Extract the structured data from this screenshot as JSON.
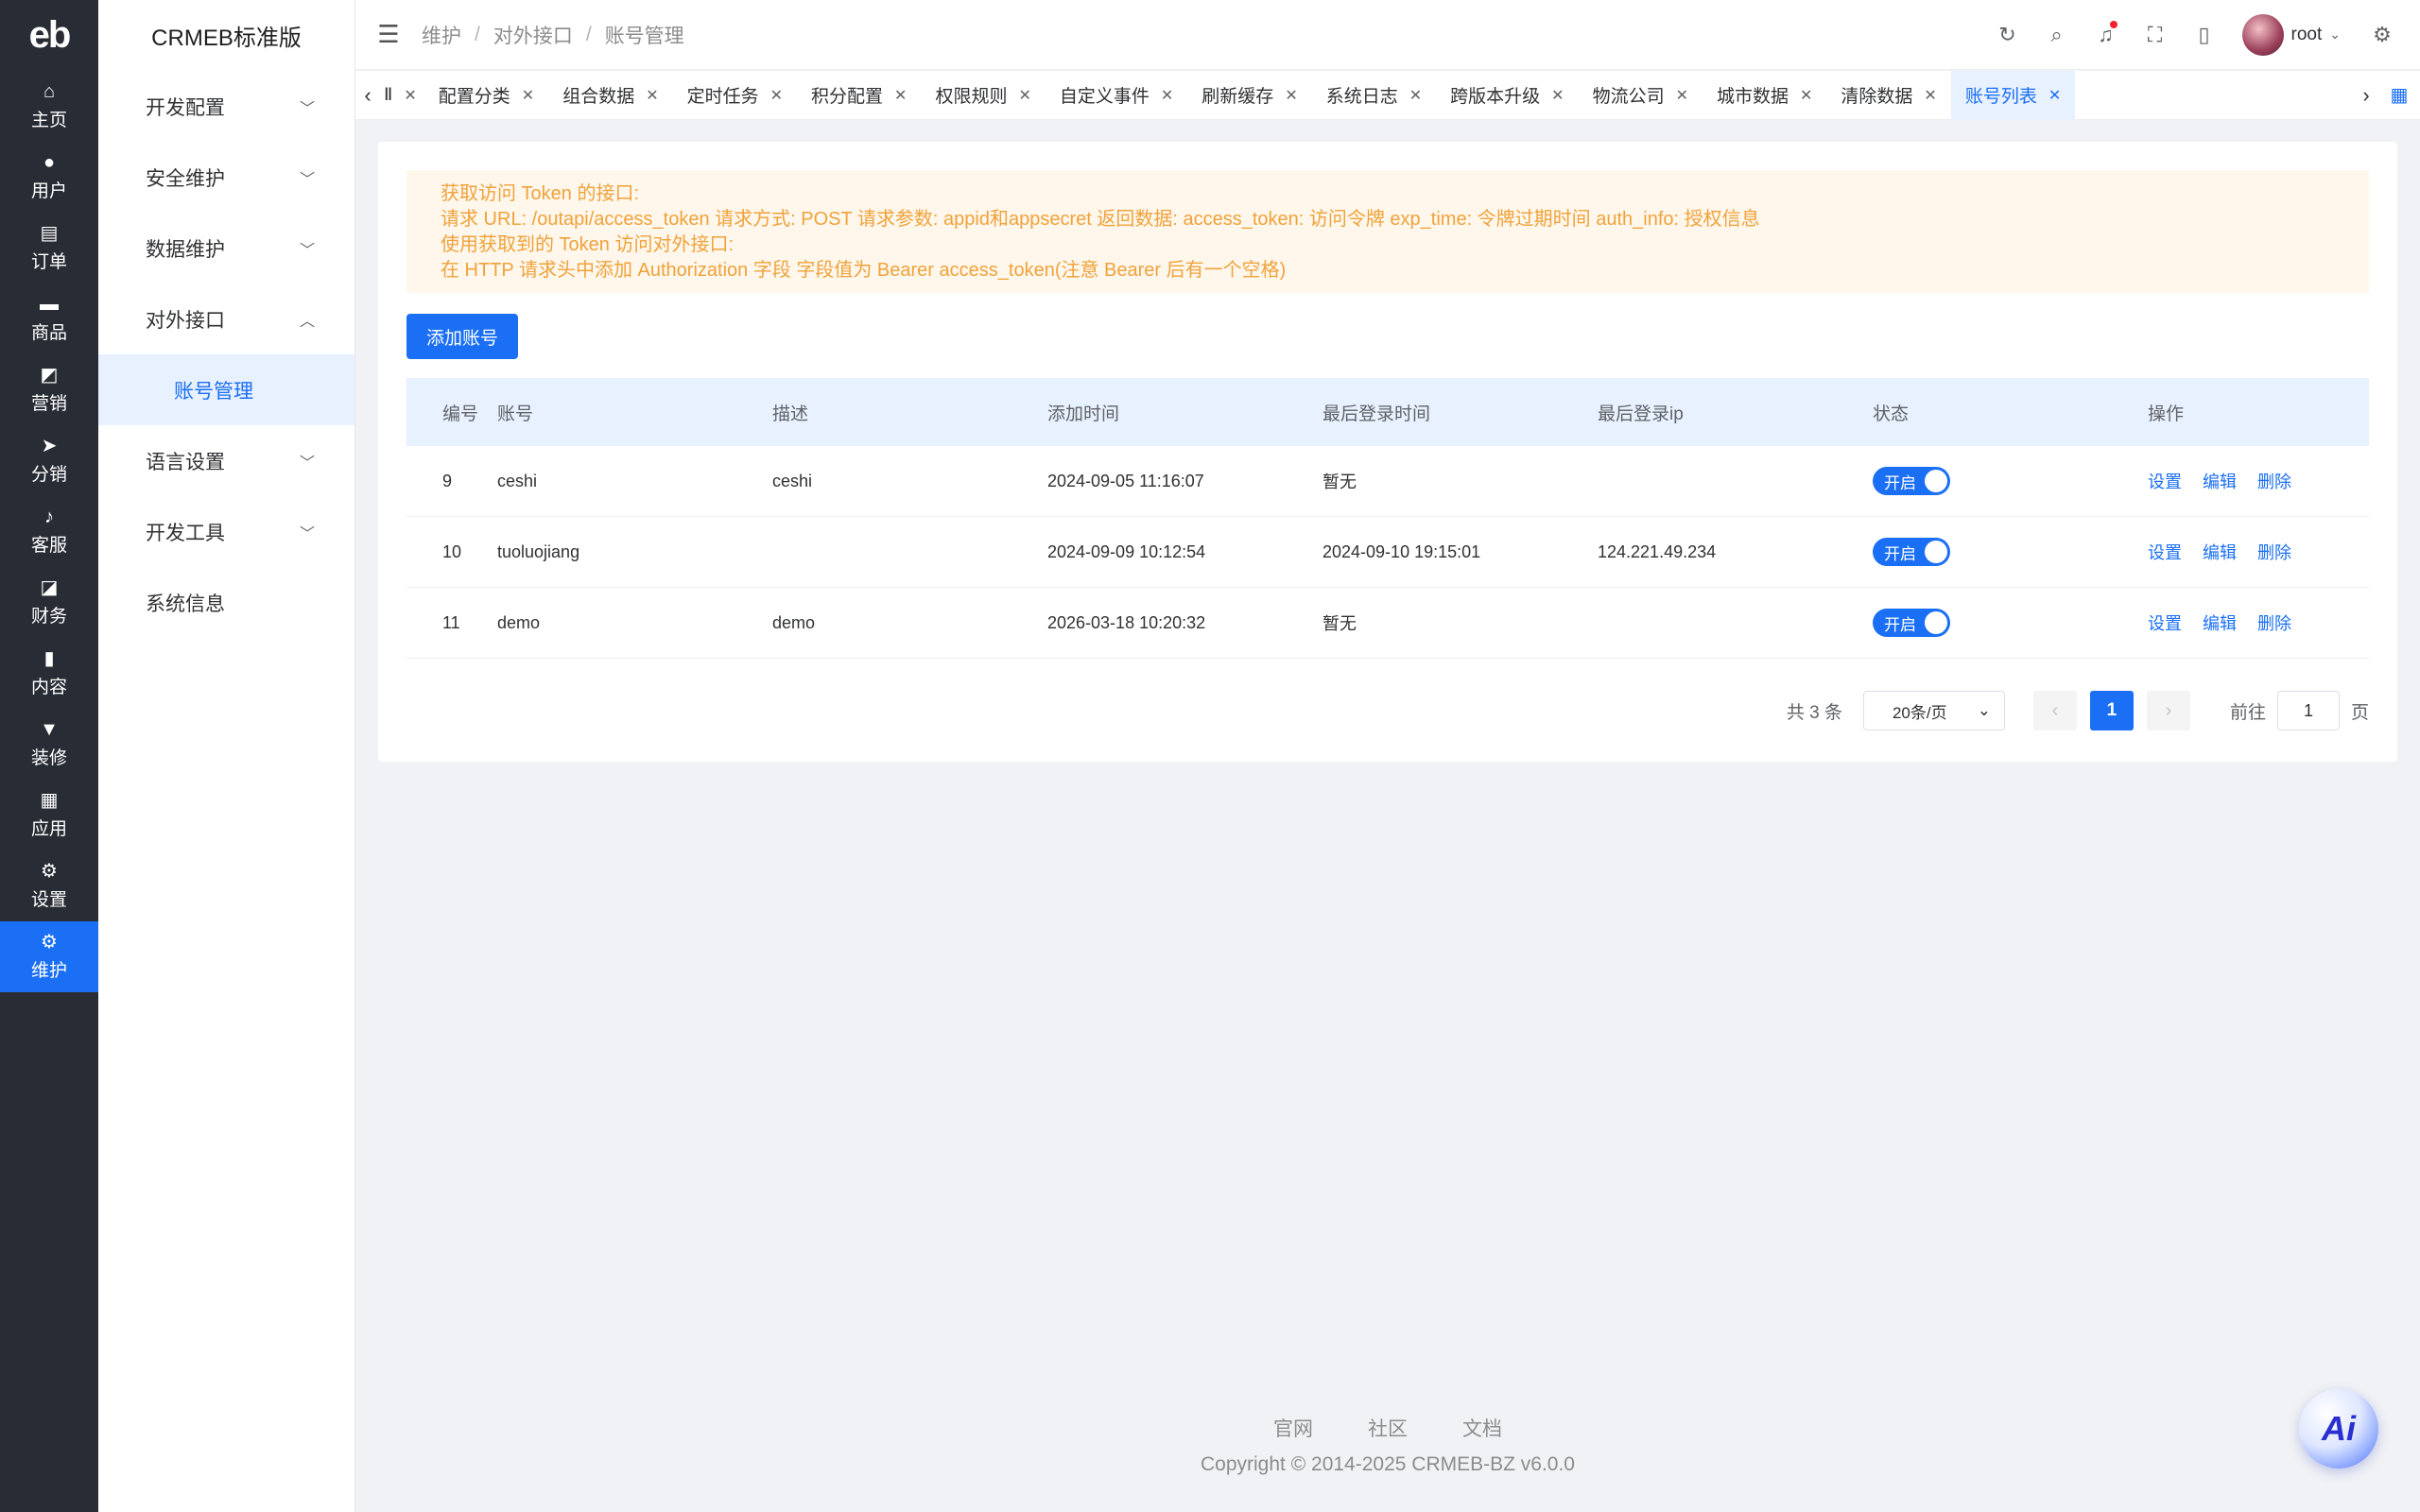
{
  "brand": {
    "logo_text": "eb",
    "app_name": "CRMEB标准版"
  },
  "main_nav": [
    {
      "label": "主页",
      "icon": "home-icon",
      "glyph": "⌂"
    },
    {
      "label": "用户",
      "icon": "user-icon",
      "glyph": "●"
    },
    {
      "label": "订单",
      "icon": "order-icon",
      "glyph": "▤"
    },
    {
      "label": "商品",
      "icon": "product-icon",
      "glyph": "▬"
    },
    {
      "label": "营销",
      "icon": "marketing-icon",
      "glyph": "◩"
    },
    {
      "label": "分销",
      "icon": "distribution-icon",
      "glyph": "➤"
    },
    {
      "label": "客服",
      "icon": "service-icon",
      "glyph": "♪"
    },
    {
      "label": "财务",
      "icon": "finance-icon",
      "glyph": "◪"
    },
    {
      "label": "内容",
      "icon": "content-icon",
      "glyph": "▮"
    },
    {
      "label": "装修",
      "icon": "decoration-icon",
      "glyph": "▼"
    },
    {
      "label": "应用",
      "icon": "apps-icon",
      "glyph": "▦"
    },
    {
      "label": "设置",
      "icon": "settings-icon",
      "glyph": "⚙"
    },
    {
      "label": "维护",
      "icon": "maintenance-icon",
      "glyph": "⚙",
      "active": true
    }
  ],
  "sub_menu": [
    {
      "label": "开发配置",
      "expanded": false
    },
    {
      "label": "安全维护",
      "expanded": false
    },
    {
      "label": "数据维护",
      "expanded": false
    },
    {
      "label": "对外接口",
      "expanded": true
    },
    {
      "label": "账号管理",
      "child": true,
      "active": true
    },
    {
      "label": "语言设置",
      "expanded": false
    },
    {
      "label": "开发工具",
      "expanded": false
    },
    {
      "label": "系统信息"
    }
  ],
  "breadcrumb": [
    "维护",
    "对外接口",
    "账号管理"
  ],
  "user": {
    "name": "root"
  },
  "tabs": [
    {
      "label": "Ⅱ",
      "partial": true
    },
    {
      "label": "配置分类"
    },
    {
      "label": "组合数据"
    },
    {
      "label": "定时任务"
    },
    {
      "label": "积分配置"
    },
    {
      "label": "权限规则"
    },
    {
      "label": "自定义事件"
    },
    {
      "label": "刷新缓存"
    },
    {
      "label": "系统日志"
    },
    {
      "label": "跨版本升级"
    },
    {
      "label": "物流公司"
    },
    {
      "label": "城市数据"
    },
    {
      "label": "清除数据"
    },
    {
      "label": "账号列表",
      "active": true
    }
  ],
  "notice": {
    "lines": [
      "获取访问 Token 的接口:",
      "请求 URL: /outapi/access_token 请求方式: POST 请求参数: appid和appsecret 返回数据: access_token: 访问令牌 exp_time: 令牌过期时间 auth_info: 授权信息",
      "使用获取到的 Token 访问对外接口:",
      "在 HTTP 请求头中添加 Authorization 字段 字段值为 Bearer access_token(注意 Bearer 后有一个空格)"
    ]
  },
  "add_button": "添加账号",
  "table": {
    "columns": [
      "编号",
      "账号",
      "描述",
      "添加时间",
      "最后登录时间",
      "最后登录ip",
      "状态",
      "操作"
    ],
    "rows": [
      {
        "id": "9",
        "account": "ceshi",
        "desc": "ceshi",
        "added": "2024-09-05 11:16:07",
        "last_login": "暂无",
        "ip": "",
        "status": "开启"
      },
      {
        "id": "10",
        "account": "tuoluojiang",
        "desc": "",
        "added": "2024-09-09 10:12:54",
        "last_login": "2024-09-10 19:15:01",
        "ip": "124.221.49.234",
        "status": "开启"
      },
      {
        "id": "11",
        "account": "demo",
        "desc": "demo",
        "added": "2026-03-18 10:20:32",
        "last_login": "暂无",
        "ip": "",
        "status": "开启"
      }
    ],
    "actions": [
      "设置",
      "编辑",
      "删除"
    ]
  },
  "pagination": {
    "total_text": "共 3 条",
    "page_size": "20条/页",
    "current_page": "1",
    "goto_label": "前往",
    "goto_value": "1",
    "page_suffix": "页"
  },
  "footer": {
    "links": [
      "官网",
      "社区",
      "文档"
    ],
    "copyright": "Copyright © 2014-2025 CRMEB-BZ v6.0.0"
  },
  "ai_button": "Ai",
  "colors": {
    "primary": "#1a6ff5",
    "nav_bg": "#282c34",
    "notice_text": "#f0a23a",
    "notice_bg": "#fff7ec"
  }
}
